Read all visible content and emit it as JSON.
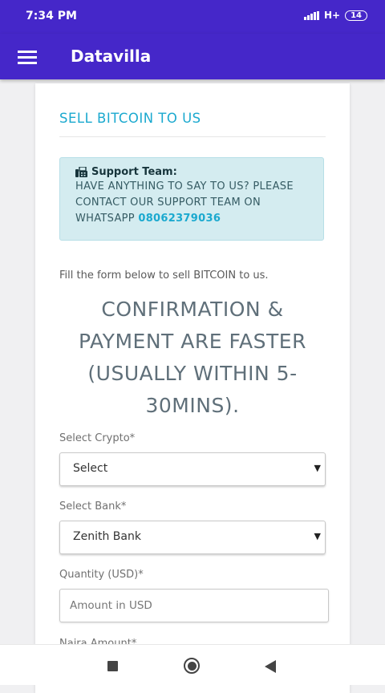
{
  "status_bar": {
    "time": "7:34 PM",
    "network": "H+",
    "battery": "14"
  },
  "app_bar": {
    "title": "Datavilla",
    "menu_icon": "hamburger-menu-icon"
  },
  "card": {
    "title": "SELL BITCOIN TO US",
    "alert": {
      "icon": "fax-icon",
      "title": "Support Team:",
      "message": "HAVE ANYTHING TO SAY TO US? PLEASE CONTACT OUR SUPPORT TEAM ON WHATSAPP",
      "phone": "08062379036"
    },
    "intro": "Fill the form below to sell BITCOIN to us.",
    "headline": "CONFIRMATION & PAYMENT ARE FASTER (USUALLY WITHIN 5-30MINS).",
    "form": {
      "crypto": {
        "label": "Select Crypto*",
        "value": "Select"
      },
      "bank": {
        "label": "Select Bank*",
        "value": "Zenith Bank"
      },
      "quantity": {
        "label": "Quantity (USD)*",
        "placeholder": "Amount in USD",
        "value": ""
      },
      "naira": {
        "label": "Naira Amount*"
      }
    }
  },
  "colors": {
    "primary": "#4527c9",
    "accent": "#1ba9cf",
    "alert_bg": "#d4ecf0"
  },
  "nav_bar": {
    "recents_icon": "square-recents-icon",
    "home_icon": "circle-home-icon",
    "back_icon": "triangle-back-icon"
  }
}
